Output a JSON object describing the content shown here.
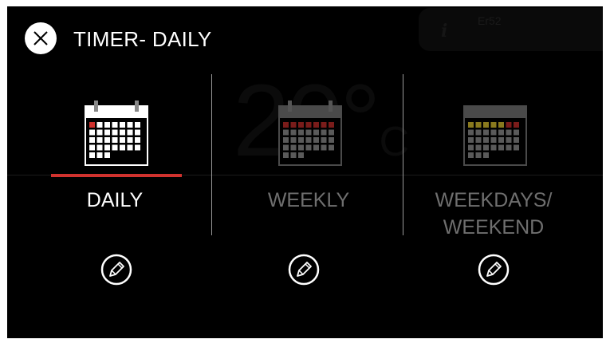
{
  "background": {
    "temperature": "20°",
    "unit": "C",
    "info_icon": "info-icon",
    "status_code": "Er52"
  },
  "header": {
    "title": "TIMER- DAILY",
    "close_icon": "close-icon"
  },
  "options": [
    {
      "label": "DAILY",
      "selected": true,
      "icon": "calendar-icon"
    },
    {
      "label": "WEEKLY",
      "selected": false,
      "icon": "calendar-icon"
    },
    {
      "label": "WEEKDAYS/\nWEEKEND",
      "selected": false,
      "icon": "calendar-icon"
    }
  ],
  "edit_icon": "pencil-icon",
  "colors": {
    "screen_bg": "#000000",
    "accent_red": "#d0322e",
    "active_text": "#ffffff",
    "inactive_text": "#6f6f6f",
    "weekday_yellow": "#8a7a1e"
  }
}
